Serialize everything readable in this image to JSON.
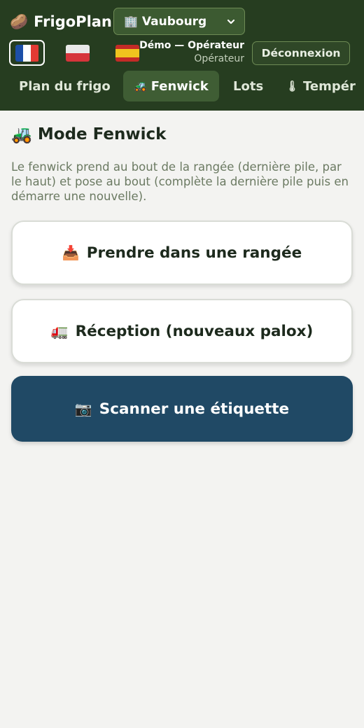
{
  "app": {
    "name": "FrigoPlan",
    "logo_glyph": "🥔"
  },
  "site": {
    "icon": "🏢",
    "selected": "Vaubourg",
    "chevron": "⌄"
  },
  "languages": [
    {
      "code": "fr",
      "label": "Français",
      "active": true,
      "colors": [
        "#1c4fa8",
        "#ffffff",
        "#e33a33"
      ]
    },
    {
      "code": "pl",
      "label": "Polski",
      "active": false,
      "colors": [
        "#e8e8e8",
        "#d6343b"
      ]
    },
    {
      "code": "es",
      "label": "Español",
      "active": false,
      "colors": [
        "#c32b27",
        "#f0c41e",
        "#c32b27"
      ]
    }
  ],
  "user": {
    "name": "Démo — Opérateur",
    "role": "Opérateur"
  },
  "logout_label": "Déconnexion",
  "nav": {
    "tabs": [
      {
        "label": "Plan du frigo",
        "icon": "",
        "active": false
      },
      {
        "label": "Fenwick",
        "icon": "🚜",
        "active": true
      },
      {
        "label": "Lots",
        "icon": "",
        "active": false
      },
      {
        "label": "Tempér",
        "icon": "🌡",
        "active": false
      }
    ]
  },
  "page": {
    "title": "Mode Fenwick",
    "title_icon": "🚜",
    "description": "Le fenwick prend au bout de la rangée (dernière pile, par le haut) et pose au bout (complète la dernière pile puis en démarre une nouvelle)."
  },
  "actions": {
    "take": {
      "icon": "📥",
      "label": "Prendre dans une rangée"
    },
    "reception": {
      "icon": "🚛",
      "label": "Réception (nouveaux palox)"
    },
    "scan": {
      "icon": "📷",
      "label": "Scanner une étiquette"
    }
  },
  "colors": {
    "header_bg": "#263d20",
    "accent_tab": "#3f5d34",
    "scan_button": "#204965"
  }
}
